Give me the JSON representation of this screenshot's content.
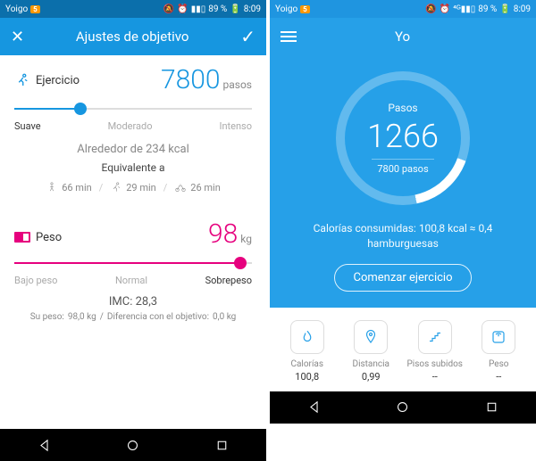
{
  "statusbar": {
    "carrier": "Yoigo",
    "notif_count": "5",
    "battery_text": "89 %",
    "time": "8:09"
  },
  "left": {
    "title": "Ajustes de objetivo",
    "exercise": {
      "label": "Ejercicio",
      "value": "7800",
      "unit": "pasos",
      "levels": {
        "soft": "Suave",
        "mod": "Moderado",
        "intense": "Intenso"
      },
      "kcal_text": "Alrededor de 234 kcal",
      "equiv_label": "Equivalente a",
      "walk": "66 min",
      "run": "29 min",
      "bike": "26 min",
      "slider_pct": 28
    },
    "weight": {
      "label": "Peso",
      "value": "98",
      "unit": "kg",
      "levels": {
        "low": "Bajo peso",
        "normal": "Normal",
        "over": "Sobrepeso"
      },
      "imc": "IMC: 28,3",
      "your_weight_lbl": "Su peso:",
      "your_weight_val": "98,0 kg",
      "diff_lbl": "Diferencia con el objetivo:",
      "diff_val": "0,0 kg",
      "slider_pct": 95
    }
  },
  "right": {
    "title": "Yo",
    "steps_label": "Pasos",
    "steps_value": "1266",
    "steps_goal": "7800 pasos",
    "calories_line": "Calorías consumidas: 100,8 kcal ≈ 0,4 hamburguesas",
    "start_label": "Comenzar ejercicio",
    "stats": {
      "cal_lbl": "Calorías",
      "cal_val": "100,8",
      "dist_lbl": "Distancia",
      "dist_val": "0,99",
      "floors_lbl": "Pisos subidos",
      "floors_val": "--",
      "weight_lbl": "Peso",
      "weight_val": "--"
    }
  }
}
